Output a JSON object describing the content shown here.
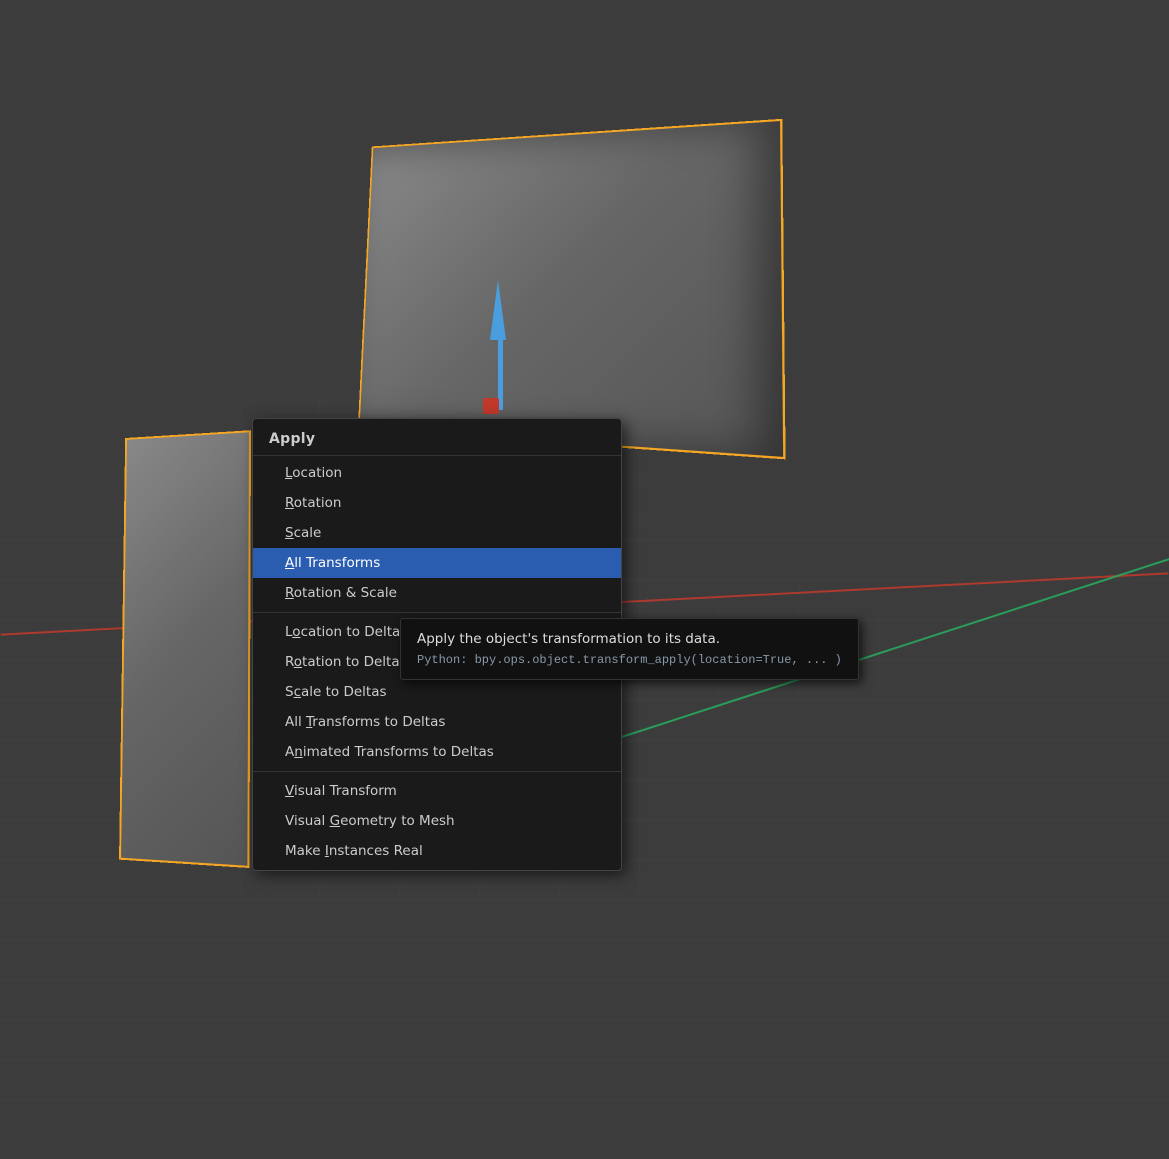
{
  "viewport": {
    "background": "#3c3c3c"
  },
  "menu": {
    "header": "Apply",
    "items": [
      {
        "id": "location",
        "label": "Location",
        "shortcut_letter": "L",
        "shortcut_index": 0,
        "active": false,
        "separator_before": false
      },
      {
        "id": "rotation",
        "label": "Rotation",
        "shortcut_letter": "R",
        "shortcut_index": 0,
        "active": false,
        "separator_before": false
      },
      {
        "id": "scale",
        "label": "Scale",
        "shortcut_letter": "S",
        "shortcut_index": 0,
        "active": false,
        "separator_before": false
      },
      {
        "id": "all-transforms",
        "label": "All Transforms",
        "shortcut_letter": "A",
        "shortcut_index": 0,
        "active": true,
        "separator_before": false
      },
      {
        "id": "rotation-scale",
        "label": "Rotation & Scale",
        "shortcut_letter": "R",
        "shortcut_index": 0,
        "active": false,
        "separator_before": false
      },
      {
        "id": "location-to-deltas",
        "label": "Location to Deltas",
        "shortcut_letter": "o",
        "shortcut_index": 1,
        "active": false,
        "separator_before": true
      },
      {
        "id": "rotation-to-deltas",
        "label": "Rotation to Deltas",
        "shortcut_letter": "o",
        "shortcut_index": 1,
        "active": false,
        "separator_before": false
      },
      {
        "id": "scale-to-deltas",
        "label": "Scale to Deltas",
        "shortcut_letter": "c",
        "shortcut_index": 1,
        "active": false,
        "separator_before": false
      },
      {
        "id": "all-transforms-to-deltas",
        "label": "All Transforms to Deltas",
        "shortcut_letter": "T",
        "shortcut_index": 4,
        "active": false,
        "separator_before": false
      },
      {
        "id": "animated-transforms-to-deltas",
        "label": "Animated Transforms to Deltas",
        "shortcut_letter": "n",
        "shortcut_index": 2,
        "active": false,
        "separator_before": false
      },
      {
        "id": "visual-transform",
        "label": "Visual Transform",
        "shortcut_letter": "V",
        "shortcut_index": 0,
        "active": false,
        "separator_before": true
      },
      {
        "id": "visual-geometry-to-mesh",
        "label": "Visual Geometry to Mesh",
        "shortcut_letter": "G",
        "shortcut_index": 7,
        "active": false,
        "separator_before": false
      },
      {
        "id": "make-instances-real",
        "label": "Make Instances Real",
        "shortcut_letter": "I",
        "shortcut_index": 5,
        "active": false,
        "separator_before": false
      }
    ]
  },
  "tooltip": {
    "title": "Apply the object's transformation to its data.",
    "python": "Python: bpy.ops.object.transform_apply(location=True, ... )"
  }
}
